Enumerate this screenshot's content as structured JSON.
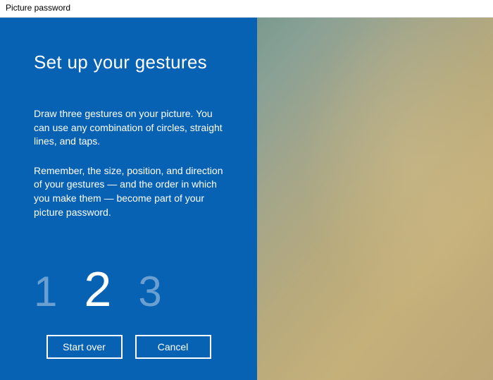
{
  "window": {
    "title": "Picture password"
  },
  "panel": {
    "heading": "Set up your gestures",
    "paragraph1": "Draw three gestures on your picture. You can use any combination of circles, straight lines, and taps.",
    "paragraph2": "Remember, the size, position, and direction of your gestures — and the order in which you make them — become part of your picture password."
  },
  "steps": {
    "s1": "1",
    "s2": "2",
    "s3": "3",
    "active": 2
  },
  "buttons": {
    "start_over": "Start over",
    "cancel": "Cancel"
  }
}
